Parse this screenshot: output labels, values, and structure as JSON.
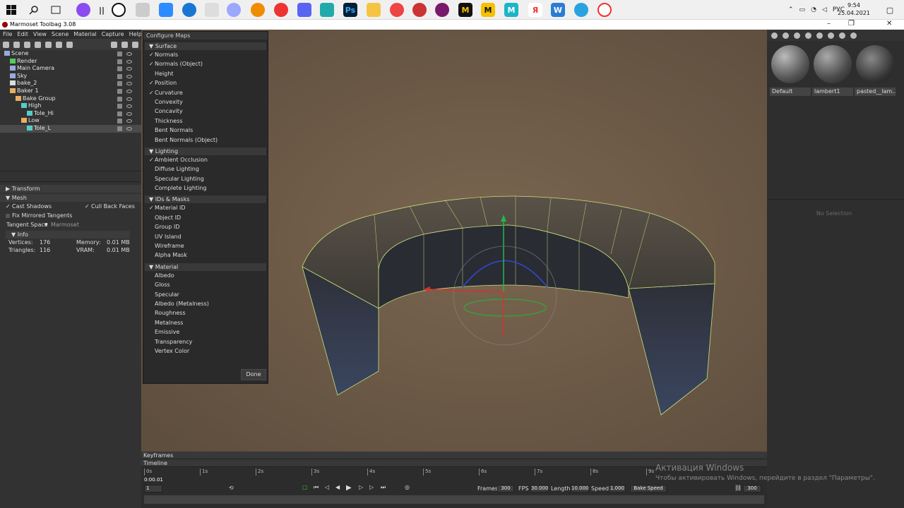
{
  "window_title": "Marmoset Toolbag 3.08",
  "menu": [
    "File",
    "Edit",
    "View",
    "Scene",
    "Material",
    "Capture",
    "Help"
  ],
  "tray": {
    "lang": "РУС",
    "time": "9:54",
    "date": "25.04.2021"
  },
  "scene_tree": [
    {
      "label": "Scene",
      "indent": 0
    },
    {
      "label": "Render",
      "indent": 1
    },
    {
      "label": "Main Camera",
      "indent": 1
    },
    {
      "label": "Sky",
      "indent": 1
    },
    {
      "label": "bake_2",
      "indent": 1
    },
    {
      "label": "Baker 1",
      "indent": 1
    },
    {
      "label": "Bake Group",
      "indent": 2
    },
    {
      "label": "High",
      "indent": 3
    },
    {
      "label": "Tole_Hi",
      "indent": 4
    },
    {
      "label": "Low",
      "indent": 3
    },
    {
      "label": "Tole_L",
      "indent": 4,
      "selected": true
    }
  ],
  "props": {
    "transform": "Transform",
    "mesh": "Mesh",
    "cast_shadows": "Cast Shadows",
    "cull_back_faces": "Cull Back Faces",
    "fix_mirrored": "Fix Mirrored Tangents",
    "tangent_space_label": "Tangent Space",
    "tangent_space_value": "Marmoset",
    "info": "Info",
    "vertices_label": "Vertices:",
    "vertices": "176",
    "triangles_label": "Triangles:",
    "triangles": "116",
    "memory_label": "Memory:",
    "memory": "0.01 MB",
    "vram_label": "VRAM:",
    "vram": "0.01 MB"
  },
  "config": {
    "title": "Configure Maps",
    "groups": [
      {
        "name": "Surface",
        "items": [
          {
            "label": "Normals",
            "checked": true
          },
          {
            "label": "Normals (Object)",
            "checked": true
          },
          {
            "label": "Height",
            "checked": false
          },
          {
            "label": "Position",
            "checked": true
          },
          {
            "label": "Curvature",
            "checked": true
          },
          {
            "label": "Convexity",
            "checked": false
          },
          {
            "label": "Concavity",
            "checked": false
          },
          {
            "label": "Thickness",
            "checked": false
          },
          {
            "label": "Bent Normals",
            "checked": false
          },
          {
            "label": "Bent Normals (Object)",
            "checked": false
          }
        ]
      },
      {
        "name": "Lighting",
        "items": [
          {
            "label": "Ambient Occlusion",
            "checked": true
          },
          {
            "label": "Diffuse Lighting",
            "checked": false
          },
          {
            "label": "Specular Lighting",
            "checked": false
          },
          {
            "label": "Complete Lighting",
            "checked": false
          }
        ]
      },
      {
        "name": "IDs & Masks",
        "items": [
          {
            "label": "Material ID",
            "checked": true
          },
          {
            "label": "Object ID",
            "checked": false
          },
          {
            "label": "Group ID",
            "checked": false
          },
          {
            "label": "UV Island",
            "checked": false
          },
          {
            "label": "Wireframe",
            "checked": false
          },
          {
            "label": "Alpha Mask",
            "checked": false
          }
        ]
      },
      {
        "name": "Material",
        "items": [
          {
            "label": "Albedo",
            "checked": false
          },
          {
            "label": "Gloss",
            "checked": false
          },
          {
            "label": "Specular",
            "checked": false
          },
          {
            "label": "Albedo (Metalness)",
            "checked": false
          },
          {
            "label": "Roughness",
            "checked": false
          },
          {
            "label": "Metalness",
            "checked": false
          },
          {
            "label": "Emissive",
            "checked": false
          },
          {
            "label": "Transparency",
            "checked": false
          },
          {
            "label": "Vertex Color",
            "checked": false
          }
        ]
      }
    ],
    "done": "Done"
  },
  "materials": [
    {
      "label": "Default"
    },
    {
      "label": "lambert1"
    },
    {
      "label": "pasted__lam..."
    }
  ],
  "no_selection": "No Selection",
  "timeline": {
    "keyframes": "Keyframes",
    "timeline": "Timeline",
    "ticks": [
      "0s",
      "1s",
      "2s",
      "3s",
      "4s",
      "5s",
      "6s",
      "7s",
      "8s",
      "9s"
    ],
    "current": "0:00.01",
    "frame": "1",
    "frames_label": "Frames",
    "frames": "300",
    "fps_label": "FPS",
    "fps": "30.000",
    "length_label": "Length",
    "length": "10.000",
    "speed_label": "Speed",
    "speed": "1.000",
    "bake_speed": "Bake Speed",
    "end": "300"
  },
  "watermark": {
    "title": "Активация Windows",
    "text": "Чтобы активировать Windows, перейдите в раздел \"Параметры\"."
  }
}
